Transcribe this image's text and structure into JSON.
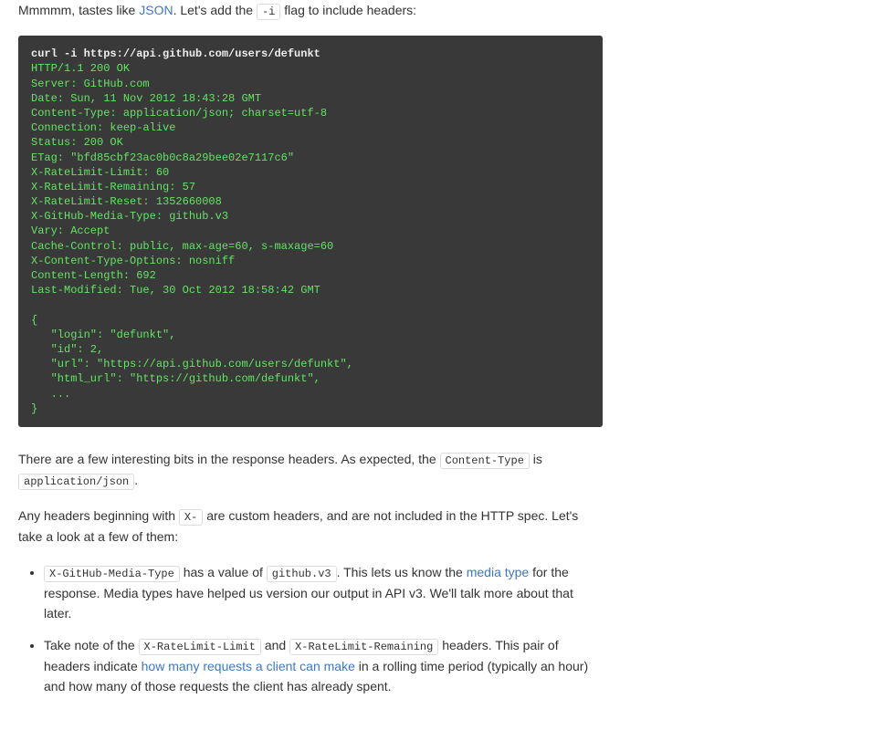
{
  "intro": {
    "pre": "Mmmmm, tastes like ",
    "json_link": "JSON",
    "mid": ". Let's add the ",
    "flag": "-i",
    "post": " flag to include headers:"
  },
  "code": {
    "command": "curl -i https://api.github.com/users/defunkt",
    "output": "HTTP/1.1 200 OK\nServer: GitHub.com\nDate: Sun, 11 Nov 2012 18:43:28 GMT\nContent-Type: application/json; charset=utf-8\nConnection: keep-alive\nStatus: 200 OK\nETag: \"bfd85cbf23ac0b0c8a29bee02e7117c6\"\nX-RateLimit-Limit: 60\nX-RateLimit-Remaining: 57\nX-RateLimit-Reset: 1352660008\nX-GitHub-Media-Type: github.v3\nVary: Accept\nCache-Control: public, max-age=60, s-maxage=60\nX-Content-Type-Options: nosniff\nContent-Length: 692\nLast-Modified: Tue, 30 Oct 2012 18:58:42 GMT\n\n{\n   \"login\": \"defunkt\",\n   \"id\": 2,\n   \"url\": \"https://api.github.com/users/defunkt\",\n   \"html_url\": \"https://github.com/defunkt\",\n   ...\n}"
  },
  "para2": {
    "pre": "There are a few interesting bits in the response headers. As expected, the ",
    "code1": "Content-Type",
    "mid": " is ",
    "code2": "application/json",
    "post": "."
  },
  "para3": {
    "pre": "Any headers beginning with ",
    "code1": "X-",
    "post": " are custom headers, and are not included in the HTTP spec. Let's take a look at a few of them:"
  },
  "li1": {
    "code1": "X-GitHub-Media-Type",
    "a": " has a value of ",
    "code2": "github.v3",
    "b": ". This lets us know the ",
    "link": "media type",
    "c": " for the response. Media types have helped us version our output in API v3. We'll talk more about that later."
  },
  "li2": {
    "a": "Take note of the ",
    "code1": "X-RateLimit-Limit",
    "b": " and ",
    "code2": "X-RateLimit-Remaining",
    "c": " headers. This pair of headers indicate ",
    "link": "how many requests a client can make",
    "d": " in a rolling time period (typically an hour) and how many of those requests the client has already spent."
  }
}
